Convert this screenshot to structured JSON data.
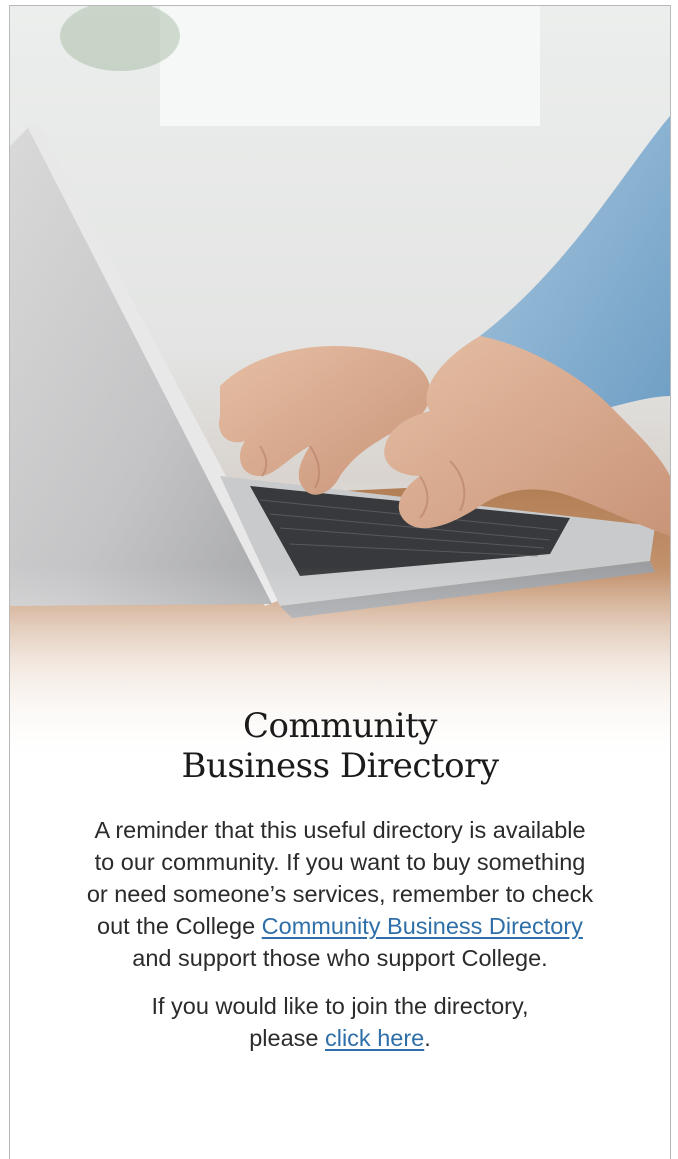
{
  "hero": {
    "image": "laptop-typing-photo"
  },
  "article": {
    "title_line1": "Community",
    "title_line2": "Business Directory",
    "para1": {
      "line1": "A reminder that this useful directory is available",
      "line2": "to our community. If you want to buy something",
      "line3": "or need someone’s services, remember to check",
      "line4_before": "out the College ",
      "link_text": "Community Business Directory",
      "line5": "and support those who support College."
    },
    "para2": {
      "line1": "If you would like to join the directory,",
      "line2_before": "please ",
      "link_text": "click here",
      "line2_after": "."
    }
  },
  "colors": {
    "link": "#2f6fa8",
    "text": "#2b2b2b",
    "title": "#1b1b1b",
    "border": "#b9b9b9"
  }
}
